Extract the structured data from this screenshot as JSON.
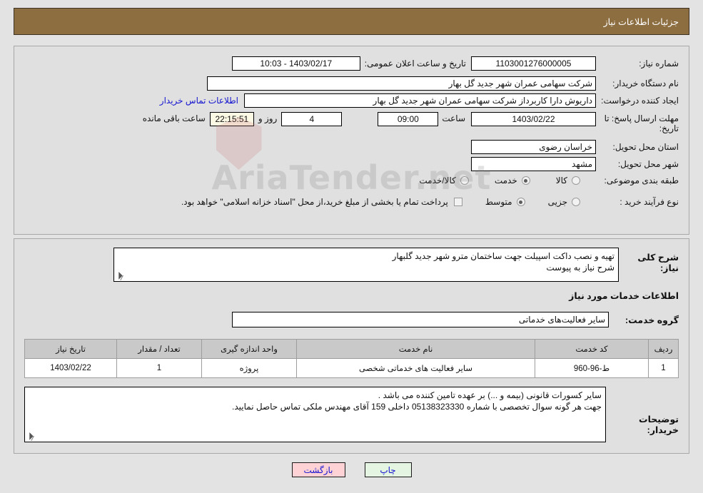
{
  "header": {
    "title": "جزئیات اطلاعات نیاز"
  },
  "form": {
    "need_number_label": "شماره نیاز:",
    "need_number_value": "1103001276000005",
    "announce_datetime_label": "تاریخ و ساعت اعلان عمومی:",
    "announce_datetime_value": "1403/02/17 - 10:03",
    "buyer_org_label": "نام دستگاه خریدار:",
    "buyer_org_value": "شرکت سهامی عمران شهر جدید گل بهار",
    "requester_label": "ایجاد کننده درخواست:",
    "requester_value": "داریوش دارا کاربرداز شرکت سهامی عمران شهر جدید گل بهار",
    "buyer_contact_link": "اطلاعات تماس خریدار",
    "deadline_label": "مهلت ارسال پاسخ: تا تاریخ:",
    "deadline_date": "1403/02/22",
    "time_label": "ساعت",
    "deadline_time": "09:00",
    "days_value": "4",
    "days_label": "روز و",
    "timer_value": "22:15:51",
    "remaining_label": "ساعت باقی مانده",
    "province_label": "استان محل تحویل:",
    "province_value": "خراسان رضوی",
    "city_label": "شهر محل تحویل:",
    "city_value": "مشهد",
    "category_label": "طبقه بندی موضوعی:",
    "category_options": [
      {
        "label": "کالا",
        "selected": false
      },
      {
        "label": "خدمت",
        "selected": true
      },
      {
        "label": "کالا/خدمت",
        "selected": false
      }
    ],
    "process_label": "نوع فرآیند خرید :",
    "process_options": [
      {
        "label": "جزیی",
        "selected": false
      },
      {
        "label": "متوسط",
        "selected": true
      }
    ],
    "treasury_checkbox_checked": false,
    "treasury_note": "پرداخت تمام یا بخشی از مبلغ خرید،از محل \"اسناد خزانه اسلامی\" خواهد بود."
  },
  "details": {
    "general_desc_label": "شرح کلی نیاز:",
    "general_desc_line1": "تهیه و نصب داکت اسپیلت جهت ساختمان مترو شهر جدید گلبهار",
    "general_desc_line2": "شرح نیاز به پیوست",
    "services_section_title": "اطلاعات خدمات مورد نیاز",
    "service_group_label": "گروه خدمت:",
    "service_group_value": "سایر فعالیت‌های خدماتی",
    "buyer_notes_label": "توضیحات خریدار:",
    "buyer_notes_line1": "سایر کسورات قانونی (بیمه و ...) بر عهده تامین کننده می باشد .",
    "buyer_notes_line2": "جهت هر گونه سوال تخصصی با شماره 05138323330 داخلی 159 آقای مهندس ملکی تماس حاصل نمایید."
  },
  "table": {
    "headers": [
      "ردیف",
      "کد خدمت",
      "نام خدمت",
      "واحد اندازه گیری",
      "تعداد / مقدار",
      "تاریخ نیاز"
    ],
    "rows": [
      {
        "row_no": "1",
        "service_code": "ط-96-960",
        "service_name": "سایر فعالیت های خدماتی شخصی",
        "unit": "پروژه",
        "quantity": "1",
        "need_date": "1403/02/22"
      }
    ]
  },
  "buttons": {
    "print": "چاپ",
    "back": "بازگشت"
  },
  "watermark": {
    "text": "AriaTender.net"
  },
  "colors": {
    "header_bg": "#8d6e41",
    "panel_bg": "#e0e0e0",
    "page_bg": "#e3e3e3",
    "link": "#1414d0",
    "print_btn": "#e4f5e2",
    "back_btn": "#ffd3d6",
    "table_header": "#c9c9c9",
    "timer_bg": "#fbf8e4"
  }
}
